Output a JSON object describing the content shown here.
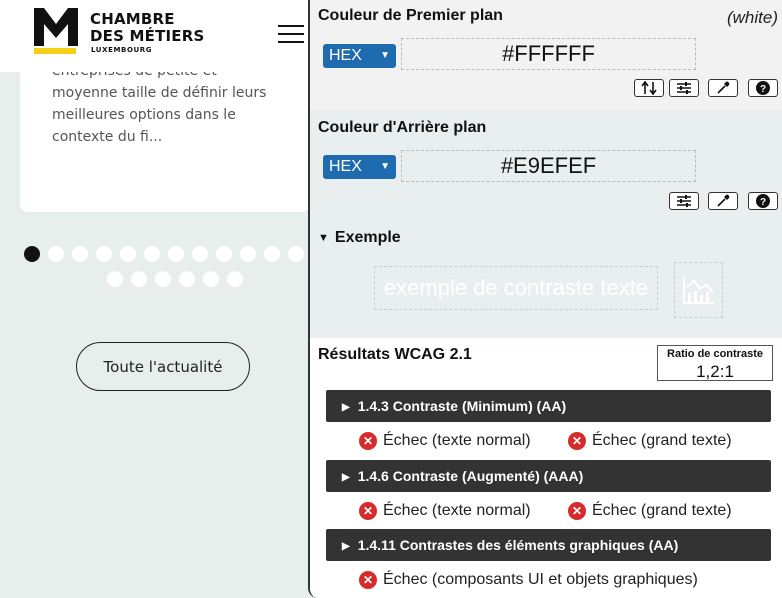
{
  "site": {
    "logo_line1": "CHAMBRE",
    "logo_line2": "DES MÉTIERS",
    "logo_line3": "LUXEMBOURG",
    "card_lines": [
      "entreprises de petite et",
      "moyenne taille de définir leurs",
      "meilleures options dans le",
      "contexte du fi..."
    ],
    "carousel": {
      "total": 19,
      "active_index": 0
    },
    "all_news_label": "Toute l'actualité"
  },
  "panel": {
    "foreground": {
      "title": "Couleur de Premier plan",
      "color_name": "(white)",
      "format": "HEX",
      "value": "#FFFFFF",
      "color": "#FFFFFF"
    },
    "background": {
      "title": "Couleur d'Arrière plan",
      "format": "HEX",
      "value": "#E9EFEF",
      "color": "#E9EFEF"
    },
    "example": {
      "title": "Exemple",
      "sample_text": "exemple de contraste texte"
    },
    "results": {
      "title": "Résultats WCAG 2.1",
      "ratio_label": "Ratio de contraste",
      "ratio_value": "1,2:1",
      "criteria": [
        {
          "label": "1.4.3 Contraste (Minimum) (AA)",
          "checks": [
            "Échec (texte normal)",
            "Échec (grand texte)"
          ]
        },
        {
          "label": "1.4.6 Contraste (Augmenté) (AAA)",
          "checks": [
            "Échec (texte normal)",
            "Échec (grand texte)"
          ]
        },
        {
          "label": "1.4.11 Contrastes des éléments graphiques (AA)",
          "checks": [
            "Échec (composants UI et objets graphiques)"
          ]
        }
      ]
    }
  },
  "colors": {
    "accent_blue": "#1f6bb0",
    "fail_red": "#d72b2b",
    "criteria_bar": "#333333",
    "logo_yellow": "#f4d017"
  }
}
